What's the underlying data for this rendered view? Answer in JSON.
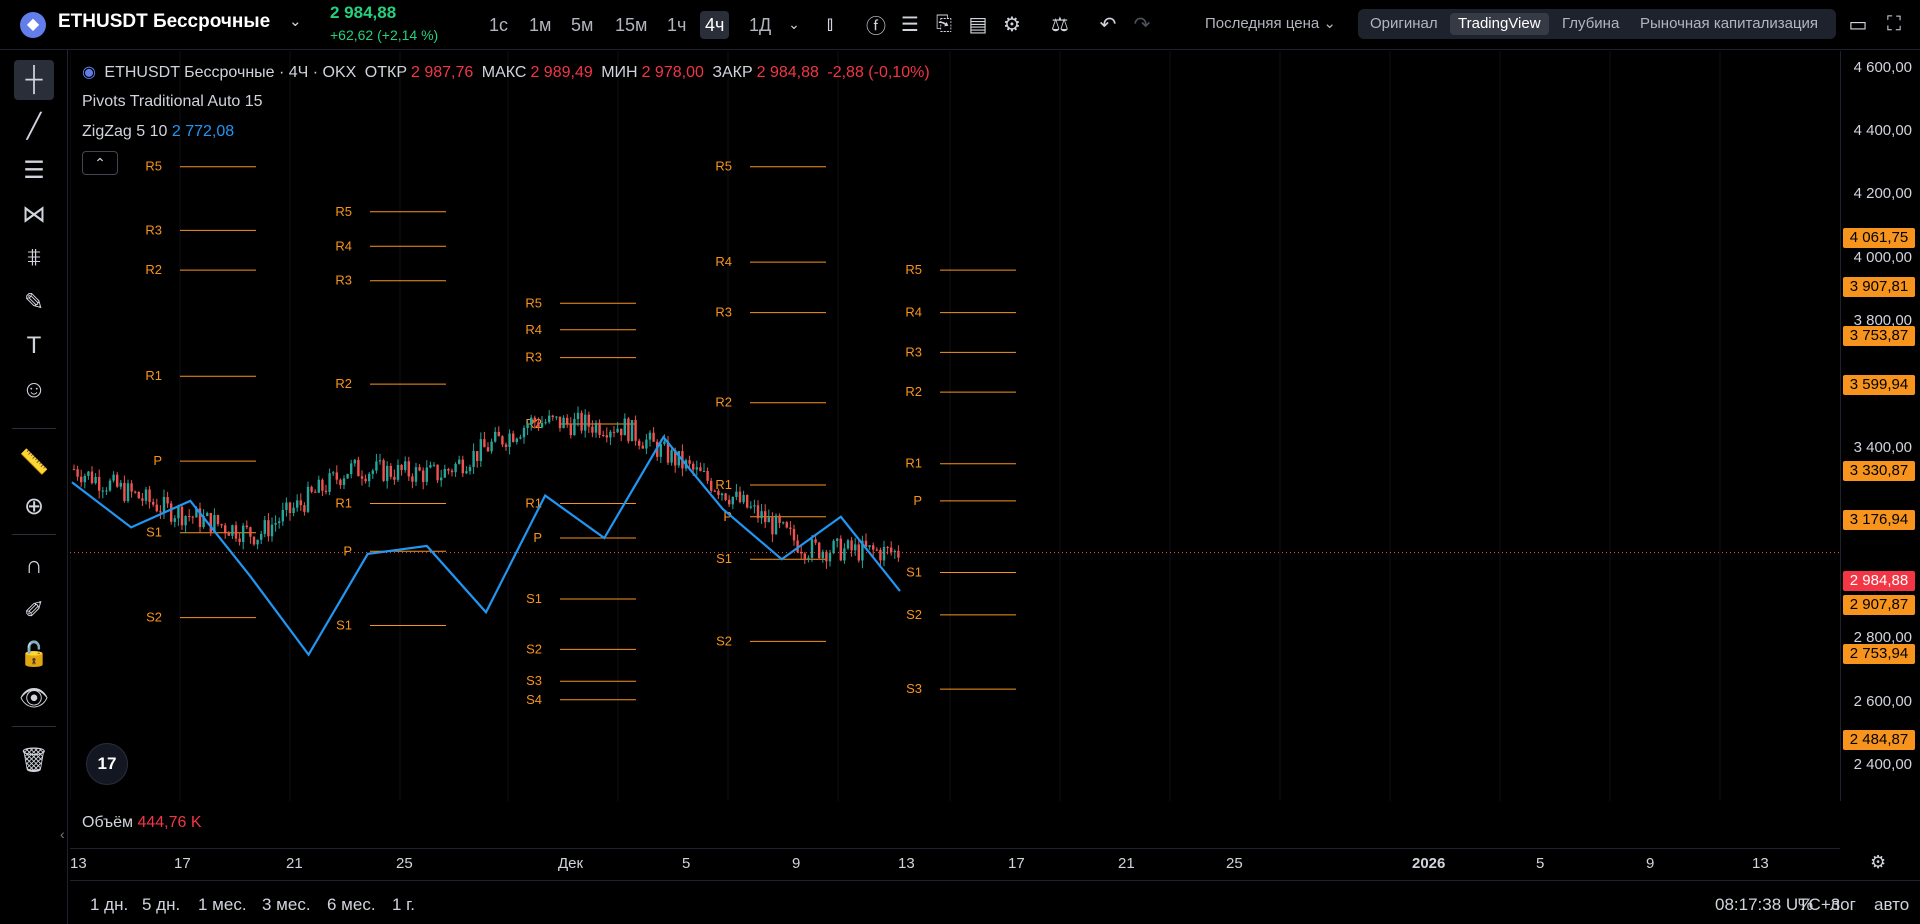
{
  "header": {
    "symbol": "ETHUSDT Бессрочные",
    "price": "2 984,88",
    "change": "+62,62 (+2,14 %)",
    "timeframes": [
      "1с",
      "1м",
      "5м",
      "15м",
      "1ч",
      "4ч",
      "1Д"
    ],
    "active_timeframe": "4ч",
    "price_type": "Последняя цена",
    "views": [
      "Оригинал",
      "TradingView",
      "Глубина",
      "Рыночная капитализация"
    ],
    "active_view": "TradingView"
  },
  "legend": {
    "title": "ETHUSDT Бессрочные · 4Ч · OKX",
    "open_label": "ОТКР",
    "open": "2 987,76",
    "high_label": "МАКС",
    "high": "2 989,49",
    "low_label": "МИН",
    "low": "2 978,00",
    "close_label": "ЗАКР",
    "close": "2 984,88",
    "change": "-2,88 (-0,10%)",
    "pivots": "Pivots Traditional Auto 15",
    "zigzag": "ZigZag 5 10",
    "zigzag_value": "2 772,08",
    "volume_label": "Объём",
    "volume_value": "444,76 K"
  },
  "price_axis": {
    "ticks": [
      "4 600,00",
      "4 400,00",
      "4 200,00",
      "4 000,00",
      "3 800,00",
      "3 400,00",
      "2 800,00",
      "2 600,00",
      "2 400,00"
    ],
    "labels": [
      "4 061,75",
      "3 907,81",
      "3 753,87",
      "3 599,94",
      "3 330,87",
      "3 176,94",
      "2 984,88",
      "2 907,87",
      "2 753,94",
      "2 484,87"
    ],
    "current_label": "2 984,88"
  },
  "time_axis": [
    "13",
    "17",
    "21",
    "25",
    "Дек",
    "5",
    "9",
    "13",
    "17",
    "21",
    "25",
    "2026",
    "5",
    "9",
    "13"
  ],
  "bottom": {
    "ranges": [
      "1 дн.",
      "5 дн.",
      "1 мес.",
      "3 мес.",
      "6 мес.",
      "1 г."
    ],
    "clock": "08:17:38 UTC+3",
    "percent": "%",
    "log": "лог",
    "auto": "авто"
  },
  "colors": {
    "up": "#26a69a",
    "down": "#ef5350",
    "pivot": "#f7941d",
    "zigzag": "#2196f3",
    "background": "#000000"
  },
  "chart_data": {
    "type": "candlestick",
    "x": [
      "2024-11-13",
      "2024-11-17",
      "2024-11-21",
      "2024-11-25",
      "2024-12-01",
      "2024-12-05",
      "2024-12-09",
      "2024-12-13",
      "2024-12-17",
      "2024-12-20"
    ],
    "close": [
      3300,
      3150,
      3050,
      3300,
      3280,
      3480,
      3460,
      3240,
      3000,
      2984.88
    ],
    "ylim": [
      2350,
      4650
    ],
    "zigzag": [
      3250,
      3080,
      3180,
      2900,
      2600,
      2980,
      3010,
      2760,
      3200,
      3040,
      3420,
      3150,
      2960,
      3120,
      2840
    ],
    "pivot_periods": [
      {
        "R5": 4440,
        "R3": 4200,
        "R2": 4050,
        "R1": 3650,
        "P": 3330,
        "S1": 3060,
        "S2": 2740
      },
      {
        "R5": 4270,
        "R4": 4140,
        "R3": 4010,
        "R2": 3620,
        "R1": 3170,
        "P": 2990,
        "S1": 2710
      },
      {
        "R5": 3925,
        "R4": 3825,
        "R3": 3720,
        "R2": 3470,
        "R1": 3170,
        "P": 3040,
        "S1": 2810,
        "S2": 2620,
        "S3": 2500,
        "S4": 2430
      },
      {
        "R5": 4440,
        "R4": 4080,
        "R3": 3890,
        "R2": 3550,
        "R1": 3240,
        "P": 3120,
        "S1": 2960,
        "S2": 2650
      },
      {
        "R5": 4050,
        "R4": 3890,
        "R3": 3740,
        "R2": 3590,
        "R1": 3320,
        "P": 3180,
        "S1": 2910,
        "S2": 2750,
        "S3": 2470
      }
    ]
  }
}
